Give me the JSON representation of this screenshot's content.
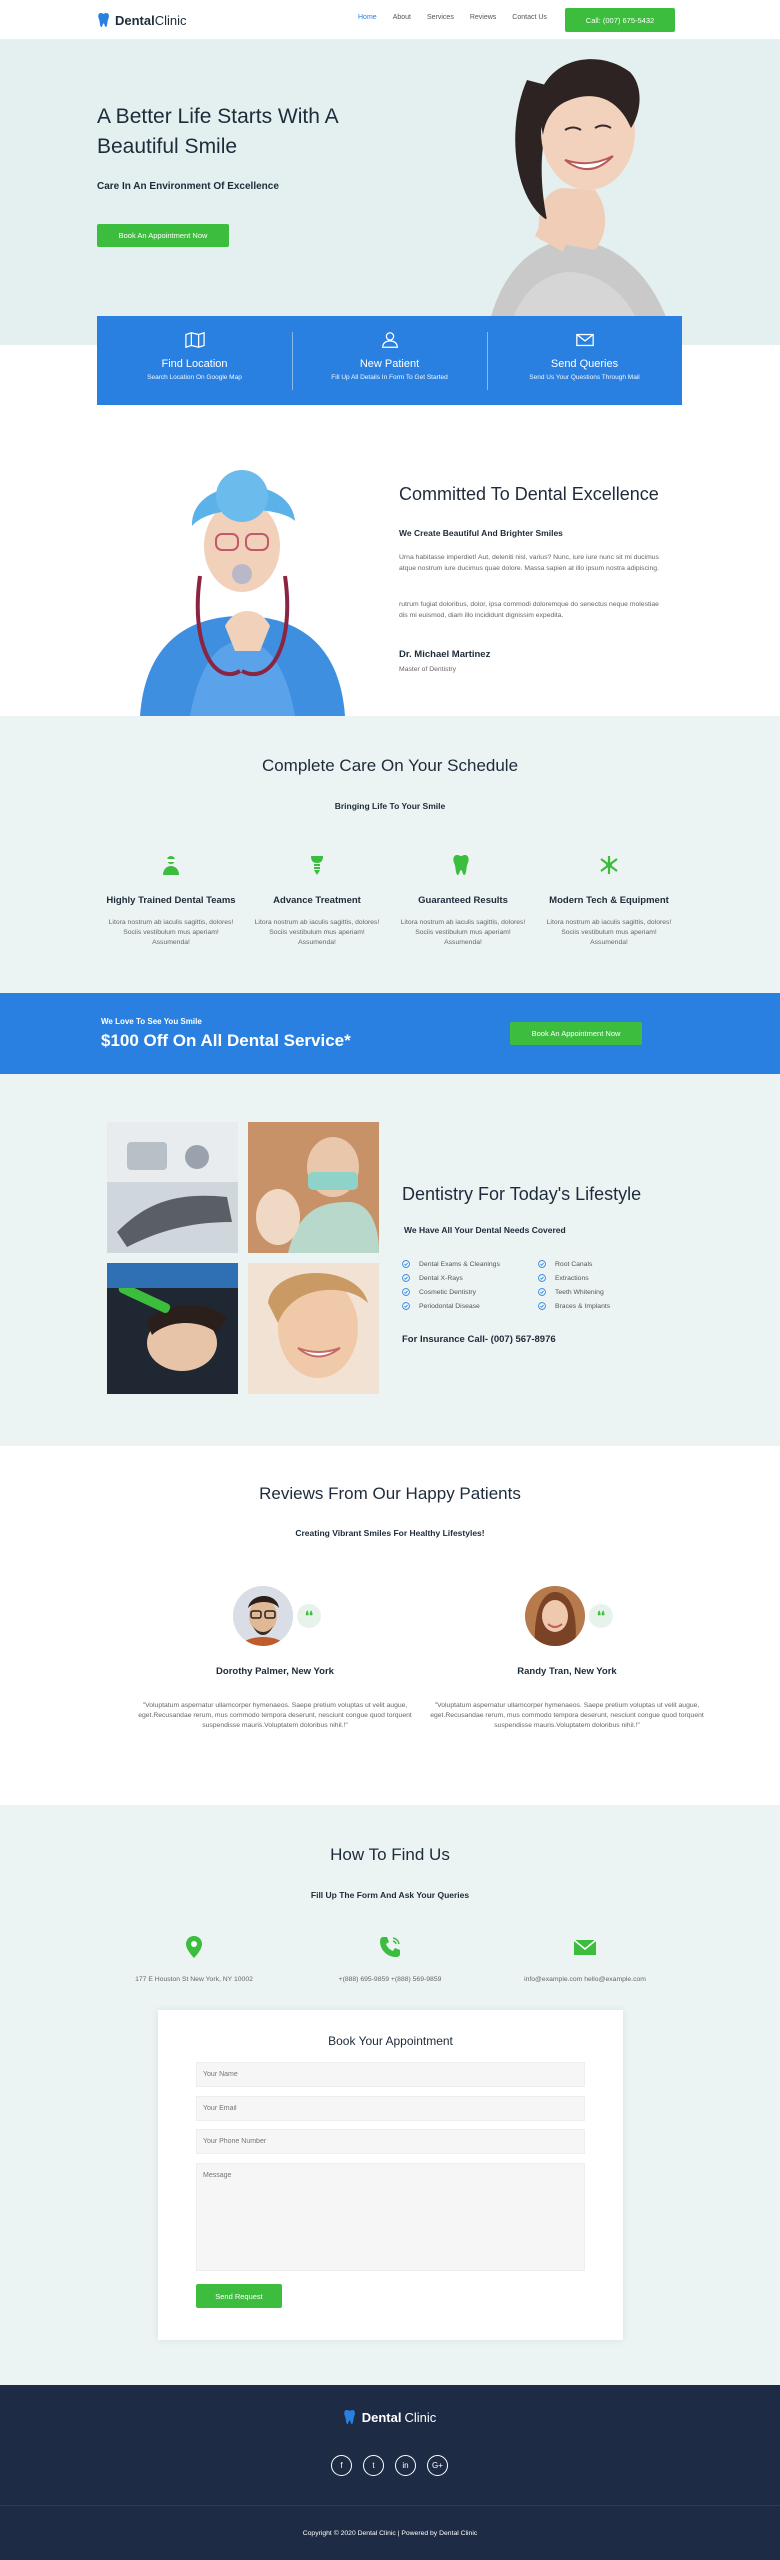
{
  "header": {
    "logo_bold": "Dental",
    "logo_light": "Clinic",
    "nav": [
      "Home",
      "About",
      "Services",
      "Reviews",
      "Contact Us"
    ],
    "call_button": "Call: (007) 675-5432"
  },
  "hero": {
    "title": "A Better Life Starts With A Beautiful Smile",
    "subtitle": "Care In An Environment Of Excellence",
    "cta": "Book An Appointment Now"
  },
  "info_strip": [
    {
      "icon": "map-icon",
      "title": "Find Location",
      "text": "Search Location On Google Map"
    },
    {
      "icon": "user-icon",
      "title": "New Patient",
      "text": "Fill Up All Details In Form To Get Started"
    },
    {
      "icon": "mail-icon",
      "title": "Send Queries",
      "text": "Send Us Your Questions Through Mail"
    }
  ],
  "committed": {
    "title": "Committed To Dental Excellence",
    "subtitle": "We Create Beautiful And Brighter Smiles",
    "p1": "Urna habitasse imperdiet! Aut, deleniti nisl, varius? Nunc, iure iure nunc sit mi ducimus atque nostrum iure ducimus quae dolore. Massa sapien at illo ipsum nostra adipiscing.",
    "p2": "rutrum fugiat doloribus, dolor, ipsa commodi doloremque do senectus neque molestiae dis mi euismod, diam illo incididunt dignissim expedita.",
    "doctor": "Dr. Michael Martinez",
    "degree": "Master of Dentistry"
  },
  "care": {
    "title": "Complete Care On Your Schedule",
    "subtitle": "Bringing Life To Your Smile",
    "features": [
      {
        "icon": "dentist-icon",
        "title": "Highly Trained Dental Teams",
        "text": "Litora nostrum ab iaculis sagittis, dolores! Sociis vestibulum mus aperiam! Assumenda!"
      },
      {
        "icon": "implant-icon",
        "title": "Advance Treatment",
        "text": "Litora nostrum ab iaculis sagittis, dolores! Sociis vestibulum mus aperiam! Assumenda!"
      },
      {
        "icon": "tooth-icon",
        "title": "Guaranteed Results",
        "text": "Litora nostrum ab iaculis sagittis, dolores! Sociis vestibulum mus aperiam! Assumenda!"
      },
      {
        "icon": "dental-tools-icon",
        "title": "Modern Tech & Equipment",
        "text": "Litora nostrum ab iaculis sagittis, dolores! Sociis vestibulum mus aperiam! Assumenda!"
      }
    ]
  },
  "promo": {
    "small": "We Love To See You Smile",
    "big": "$100 Off On All Dental Service*",
    "button": "Book An Appointment Now"
  },
  "lifestyle": {
    "title": "Dentistry For Today's Lifestyle",
    "subtitle": "We Have All Your Dental Needs Covered",
    "services_left": [
      "Dental Exams & Cleanings",
      "Dental X-Rays",
      "Cosmetic Dentistry",
      "Periodontal Disease"
    ],
    "services_right": [
      "Root Canals",
      "Extractions",
      "Teeth Whitening",
      "Braces & Implants"
    ],
    "insurance": "For Insurance Call- (007) 567-8976"
  },
  "reviews": {
    "title": "Reviews From Our Happy Patients",
    "subtitle": "Creating Vibrant Smiles For Healthy Lifestyles!",
    "items": [
      {
        "name": "Dorothy Palmer, New York",
        "text": "\"Voluptatum aspernatur ullamcorper hymenaeos. Saepe pretium voluptas ut velit augue, eget.Recusandae rerum, mus commodo tempora deserunt, nesciunt congue quod torquent suspendisse mauris.Voluptatem doloribus nihil.!\""
      },
      {
        "name": "Randy Tran, New York",
        "text": "\"Voluptatum aspernatur ullamcorper hymenaeos. Saepe pretium voluptas ut velit augue, eget.Recusandae rerum, mus commodo tempora deserunt, nesciunt congue quod torquent suspendisse mauris.Voluptatem doloribus nihil.!\""
      }
    ]
  },
  "find": {
    "title": "How To Find Us",
    "subtitle": "Fill Up The Form And Ask Your Queries",
    "address": "177 E Houston St New York, NY 10002",
    "phone": "+(888) 695-9859 +(888) 569-9859",
    "email": "info@example.com hello@example.com"
  },
  "form": {
    "title": "Book Your Appointment",
    "name_placeholder": "Your Name",
    "email_placeholder": "Your Email",
    "phone_placeholder": "Your Phone Number",
    "message_placeholder": "Message",
    "submit": "Send Request"
  },
  "footer": {
    "logo_bold": "Dental",
    "logo_light": "Clinic",
    "social": [
      "f",
      "t",
      "in",
      "G+"
    ],
    "copyright": "Copyright © 2020 Dental Clinic | Powered by Dental Clinic"
  },
  "colors": {
    "accent_blue": "#2a80e0",
    "green": "#3dbd3d",
    "dark": "#1e2b44",
    "mint": "#ebf4f3"
  }
}
